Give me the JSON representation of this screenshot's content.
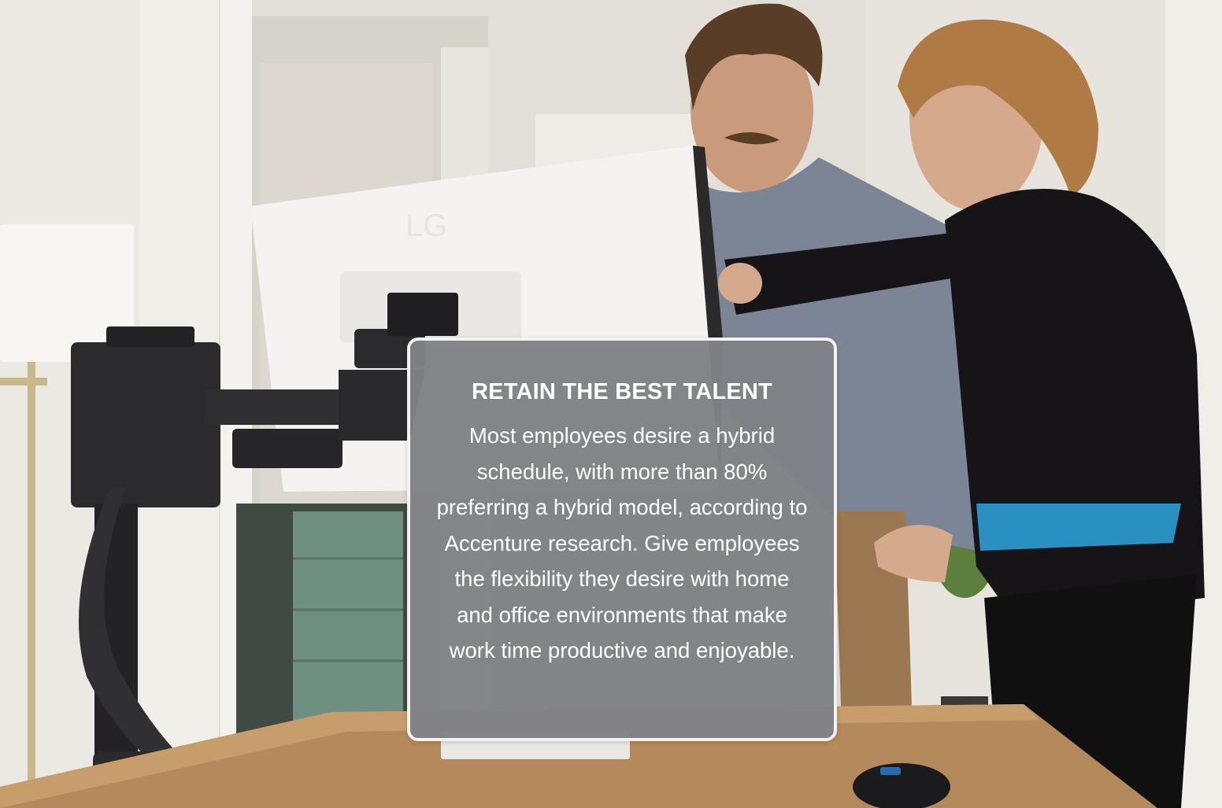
{
  "card": {
    "title": "RETAIN THE BEST TALENT",
    "body": "Most employees desire a hybrid schedule, with more than 80% preferring a hybrid model, according to Accenture research. Give employees the flexibility they desire with home and office environments that make work time productive and enjoyable."
  },
  "photo": {
    "monitor_logo": "LG"
  },
  "colors": {
    "card_background": "#808185",
    "card_border": "#f2f2f2",
    "card_text": "#ffffff"
  }
}
